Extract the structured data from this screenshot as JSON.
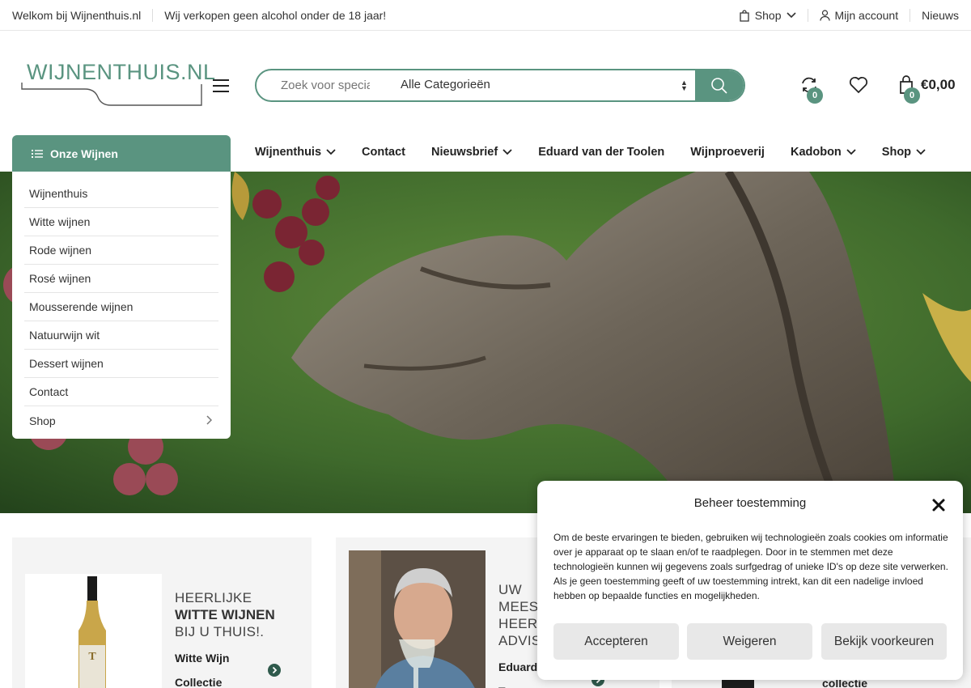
{
  "topbar": {
    "welcome": "Welkom bij Wijnenthuis.nl",
    "age_notice": "Wij verkopen geen alcohol onder de 18 jaar!",
    "shop": "Shop",
    "account": "Mijn account",
    "news": "Nieuws"
  },
  "header": {
    "logo_text": "WIJNENTHUIS.NL",
    "search_placeholder": "Zoek voor speciale",
    "category_select": "Alle Categorieën",
    "compare_count": "0",
    "cart_count": "0",
    "cart_total": "€0,00"
  },
  "nav": {
    "categories_button": "Onze Wijnen",
    "items": [
      {
        "label": "Wijnenthuis",
        "has_dropdown": true
      },
      {
        "label": "Contact",
        "has_dropdown": false
      },
      {
        "label": "Nieuwsbrief",
        "has_dropdown": true
      },
      {
        "label": "Eduard van der Toolen",
        "has_dropdown": false
      },
      {
        "label": "Wijnproeverij",
        "has_dropdown": false
      },
      {
        "label": "Kadobon",
        "has_dropdown": true
      },
      {
        "label": "Shop",
        "has_dropdown": true
      }
    ]
  },
  "sidemenu": {
    "items": [
      "Wijnenthuis",
      "Witte wijnen",
      "Rode wijnen",
      "Rosé wijnen",
      "Mousserende wijnen",
      "Natuurwijn wit",
      "Dessert wijnen",
      "Contact",
      "Shop"
    ]
  },
  "cards": [
    {
      "line1": "HEERLIJKE",
      "line2": "WITTE WIJNEN",
      "line3": "BIJ U THUIS!.",
      "link_line1": "Witte Wijn",
      "link_line2": "Collectie"
    },
    {
      "line1": "UW",
      "line2": "MEEST",
      "line3": "HEER",
      "line4": "ADVIS",
      "link_line1": "Eduard",
      "link_line2": "T"
    },
    {
      "link_line2": "collectie"
    }
  ],
  "consent": {
    "title": "Beheer toestemming",
    "body": "Om de beste ervaringen te bieden, gebruiken wij technologieën zoals cookies om informatie over je apparaat op te slaan en/of te raadplegen. Door in te stemmen met deze technologieën kunnen wij gegevens zoals surfgedrag of unieke ID's op deze site verwerken. Als je geen toestemming geeft of uw toestemming intrekt, kan dit een nadelige invloed hebben op bepaalde functies en mogelijkheden.",
    "accept": "Accepteren",
    "deny": "Weigeren",
    "preferences": "Bekijk voorkeuren"
  },
  "colors": {
    "accent": "#5a9480",
    "dark_accent": "#2f5a4c"
  }
}
